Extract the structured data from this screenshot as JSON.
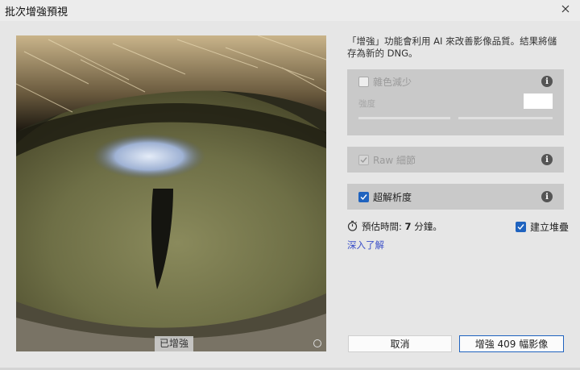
{
  "window": {
    "title": "批次增強預視",
    "close_glyph": "✕"
  },
  "preview": {
    "badge": "已增強"
  },
  "description": "「增強」功能會利用 AI 來改善影像品質。結果將儲存為新的 DNG。",
  "options": {
    "denoise": {
      "label": "雜色減少",
      "checked": false,
      "enabled": false,
      "strength_label": "強度"
    },
    "raw_details": {
      "label": "Raw 細節",
      "checked": true,
      "enabled": false
    },
    "super_resolution": {
      "label": "超解析度",
      "checked": true,
      "enabled": true
    },
    "info_glyph": "i"
  },
  "estimate": {
    "prefix": "預估時間:",
    "value": "7",
    "suffix": "分鐘。"
  },
  "create_stack": {
    "label": "建立堆疊",
    "checked": true
  },
  "learn_more": "深入了解",
  "buttons": {
    "cancel": "取消",
    "enhance": "增強 409 幅影像"
  },
  "colors": {
    "accent": "#1f63bf",
    "link": "#3a4fc8",
    "panel": "#c9c9c9"
  }
}
